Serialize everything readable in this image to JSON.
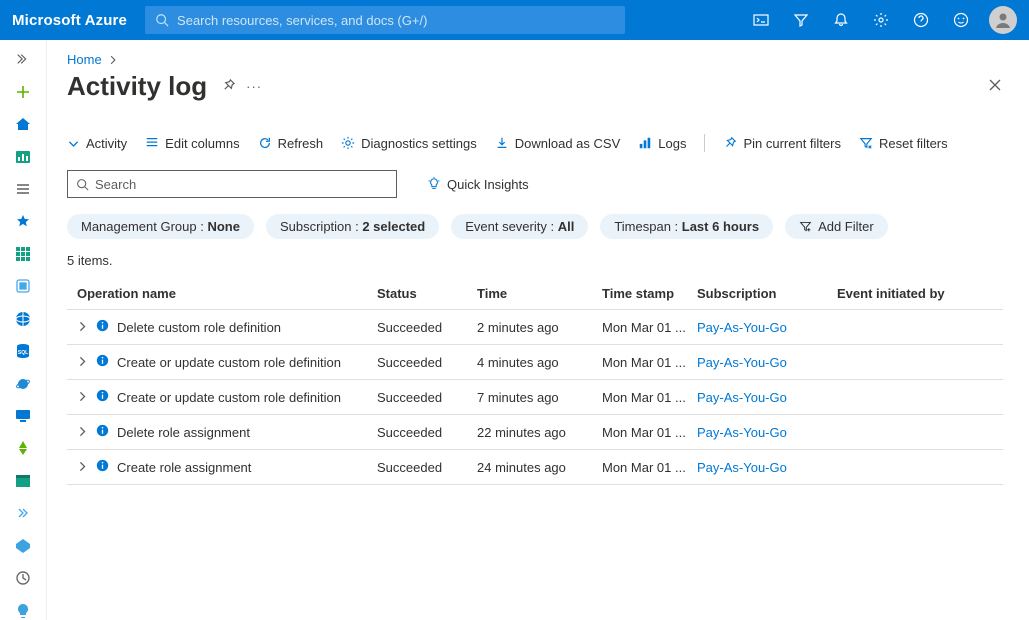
{
  "header": {
    "brand": "Microsoft Azure",
    "search_placeholder": "Search resources, services, and docs (G+/)"
  },
  "breadcrumb": {
    "home": "Home"
  },
  "page": {
    "title": "Activity log"
  },
  "toolbar": {
    "activity": "Activity",
    "edit_columns": "Edit columns",
    "refresh": "Refresh",
    "diagnostics": "Diagnostics settings",
    "download_csv": "Download as CSV",
    "logs": "Logs",
    "pin_filters": "Pin current filters",
    "reset_filters": "Reset filters"
  },
  "searchline": {
    "placeholder": "Search",
    "quick_insights": "Quick Insights"
  },
  "filters": {
    "mg_label": "Management Group : ",
    "mg_value": "None",
    "sub_label": "Subscription : ",
    "sub_value": "2 selected",
    "sev_label": "Event severity : ",
    "sev_value": "All",
    "time_label": "Timespan : ",
    "time_value": "Last 6 hours",
    "add_filter": "Add Filter"
  },
  "count_text": "5 items.",
  "columns": {
    "op": "Operation name",
    "status": "Status",
    "time": "Time",
    "timestamp": "Time stamp",
    "subscription": "Subscription",
    "initiated": "Event initiated by"
  },
  "rows": [
    {
      "op": "Delete custom role definition",
      "status": "Succeeded",
      "time": "2 minutes ago",
      "ts": "Mon Mar 01 ...",
      "sub": "Pay-As-You-Go",
      "init": ""
    },
    {
      "op": "Create or update custom role definition",
      "status": "Succeeded",
      "time": "4 minutes ago",
      "ts": "Mon Mar 01 ...",
      "sub": "Pay-As-You-Go",
      "init": ""
    },
    {
      "op": "Create or update custom role definition",
      "status": "Succeeded",
      "time": "7 minutes ago",
      "ts": "Mon Mar 01 ...",
      "sub": "Pay-As-You-Go",
      "init": ""
    },
    {
      "op": "Delete role assignment",
      "status": "Succeeded",
      "time": "22 minutes ago",
      "ts": "Mon Mar 01 ...",
      "sub": "Pay-As-You-Go",
      "init": ""
    },
    {
      "op": "Create role assignment",
      "status": "Succeeded",
      "time": "24 minutes ago",
      "ts": "Mon Mar 01 ...",
      "sub": "Pay-As-You-Go",
      "init": ""
    }
  ]
}
